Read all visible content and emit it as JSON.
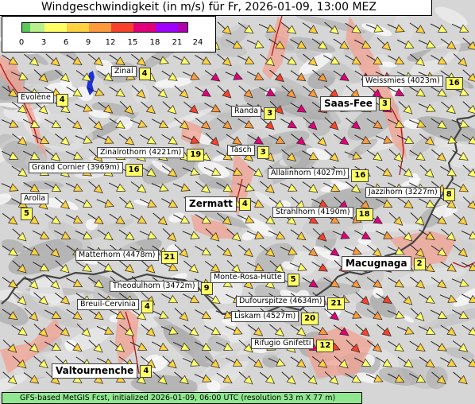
{
  "title": "Windgeschwindigkeit (in m/s) für Fr, 2026-01-09, 13:00 MEZ",
  "footer": "GFS-based MetGIS Fcst, initialized 2026-01-09, 06:00 UTC  (resolution 53 m X 77 m)",
  "legend": {
    "unit": "m/s",
    "ticks": [
      "0",
      "3",
      "6",
      "9",
      "12",
      "15",
      "18",
      "21",
      "24"
    ],
    "colors": [
      "#5cc85c",
      "#b7f08c",
      "#ffff66",
      "#ffd23f",
      "#ff9a3c",
      "#f8432a",
      "#e2007a",
      "#a000ff",
      "#b000b0"
    ]
  },
  "places": [
    {
      "name": "Zinal",
      "value": "4"
    },
    {
      "name": "Evolène",
      "value": "4"
    },
    {
      "name": "Weissmies (4023m)",
      "value": "16"
    },
    {
      "name": "Saas-Fee",
      "value": "3"
    },
    {
      "name": "Randa",
      "value": "3"
    },
    {
      "name": "Täsch",
      "value": "3"
    },
    {
      "name": "Zinalrothorn (4221m)",
      "value": "19"
    },
    {
      "name": "Grand Cornier (3969m)",
      "value": "16"
    },
    {
      "name": "Allalinhorn (4027m)",
      "value": "16"
    },
    {
      "name": "Arolla",
      "value": "5"
    },
    {
      "name": "Zermatt",
      "value": "4"
    },
    {
      "name": "Jazzihorn (3227m)",
      "value": "8"
    },
    {
      "name": "Strahlhorn (4190m)",
      "value": "18"
    },
    {
      "name": "Matterhorn (4478m)",
      "value": "21"
    },
    {
      "name": "Macugnaga",
      "value": "2"
    },
    {
      "name": "Monte-Rosa-Hütte",
      "value": "5"
    },
    {
      "name": "Theodulhorn (3472m)",
      "value": "9"
    },
    {
      "name": "Dufourspitze (4634m)",
      "value": "21"
    },
    {
      "name": "Breuil-Cervinia",
      "value": "4"
    },
    {
      "name": "Liskam (4527m)",
      "value": "20"
    },
    {
      "name": "Rifugio Gnifetti",
      "value": "12"
    },
    {
      "name": "Valtournenche",
      "value": "4"
    }
  ],
  "colors": {
    "border": "#444444",
    "river": "#b01818",
    "lake": "#1a2fe0",
    "glacier_rim": "#f08a7a"
  }
}
